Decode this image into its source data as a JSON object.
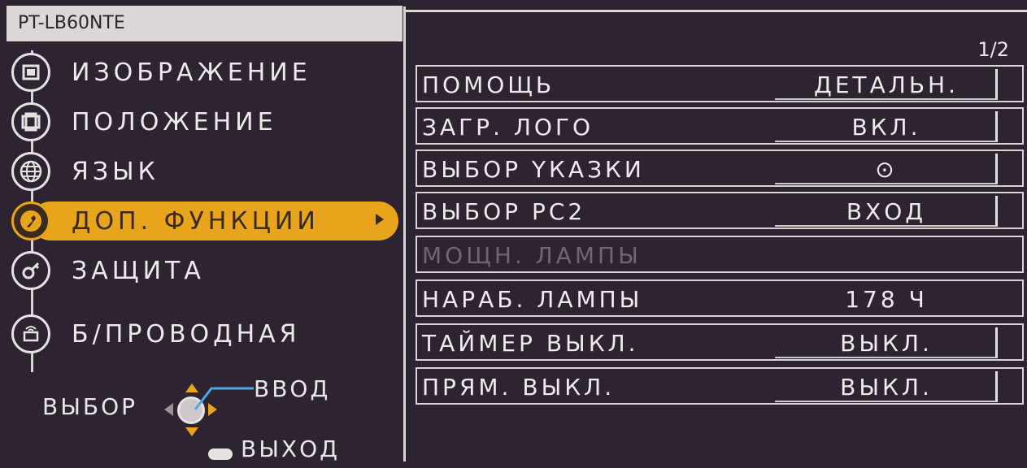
{
  "model": "PT-LB60NTE",
  "page_indicator": "1/2",
  "menu": [
    {
      "label": "ИЗОБРАЖЕНИЕ",
      "icon": "picture-icon",
      "selected": false
    },
    {
      "label": "ПОЛОЖЕНИЕ",
      "icon": "position-icon",
      "selected": false
    },
    {
      "label": "ЯЗЫК",
      "icon": "globe-icon",
      "selected": false
    },
    {
      "label": "ДОП. ФУНКЦИИ",
      "icon": "wrench-icon",
      "selected": true
    },
    {
      "label": "ЗАЩИТА",
      "icon": "key-icon",
      "selected": false
    },
    {
      "label": "Б/ПРОВОДНАЯ",
      "icon": "wireless-icon",
      "selected": false
    }
  ],
  "settings": [
    {
      "label": "ПОМОЩЬ",
      "value": "ДЕТАЛЬН."
    },
    {
      "label": "ЗАГР. ЛОГО",
      "value": "ВКЛ."
    },
    {
      "label": "ВЫБОР YКАЗКИ",
      "value": "⊙"
    },
    {
      "label": "ВЫБОР PC2",
      "value": "ВХОД"
    },
    {
      "label": "МОЩН. ЛАМПЫ",
      "value": ""
    },
    {
      "label": "НАРАБ. ЛАМПЫ",
      "value": "178 Ч"
    },
    {
      "label": "ТАЙМЕР ВЫКЛ.",
      "value": "ВЫКЛ."
    },
    {
      "label": "ПРЯМ. ВЫКЛ.",
      "value": "ВЫКЛ."
    }
  ],
  "nav": {
    "select": "ВЫБОР",
    "enter": "ВВОД",
    "exit": "ВЫХОД"
  },
  "colors": {
    "background": "#2e2330",
    "highlight": "#e8a51c",
    "text": "#efebed",
    "disabled_text": "#6f6670"
  }
}
